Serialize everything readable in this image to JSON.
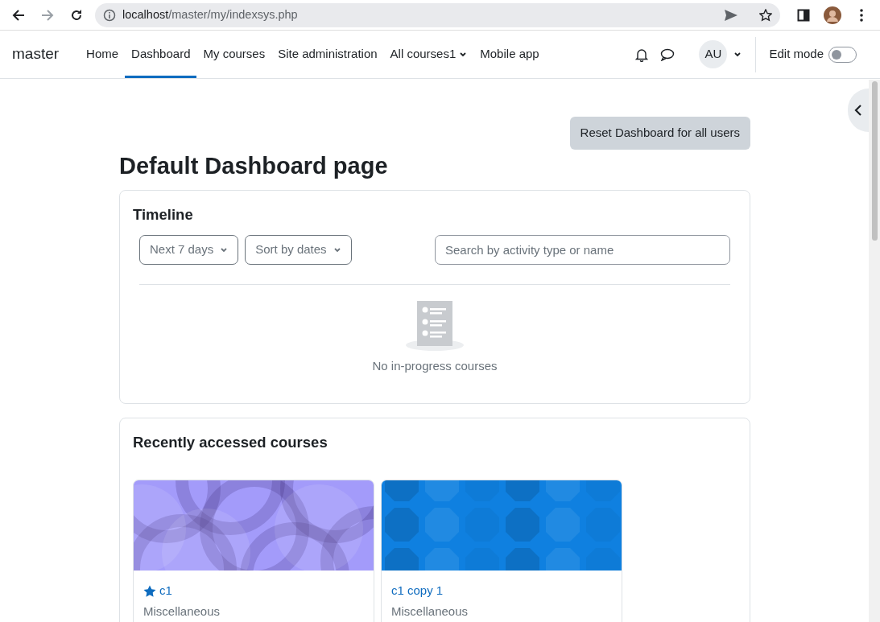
{
  "browser": {
    "url_host": "localhost",
    "url_path": "/master/my/indexsys.php"
  },
  "navbar": {
    "brand": "master",
    "items": [
      {
        "label": "Home",
        "selected": false,
        "dropdown": false
      },
      {
        "label": "Dashboard",
        "selected": true,
        "dropdown": false
      },
      {
        "label": "My courses",
        "selected": false,
        "dropdown": false
      },
      {
        "label": "Site administration",
        "selected": false,
        "dropdown": false
      },
      {
        "label": "All courses1",
        "selected": false,
        "dropdown": true
      },
      {
        "label": "Mobile app",
        "selected": false,
        "dropdown": false
      }
    ],
    "avatar": "AU",
    "edit_mode": {
      "label": "Edit mode",
      "on": false
    }
  },
  "reset_button": "Reset Dashboard for all users",
  "page_title": "Default Dashboard page",
  "timeline": {
    "title": "Timeline",
    "filters": [
      {
        "label": "Next 7 days"
      },
      {
        "label": "Sort by dates"
      }
    ],
    "search": {
      "placeholder": "Search by activity type or name"
    },
    "empty_text": "No in-progress courses"
  },
  "recent": {
    "title": "Recently accessed courses",
    "courses": [
      {
        "name": "c1",
        "category": "Miscellaneous",
        "starred": true,
        "kind": "circles",
        "color": "#a39bfa"
      },
      {
        "name": "c1 copy 1",
        "category": "Miscellaneous",
        "starred": false,
        "kind": "octagons",
        "color": "#0f80e0"
      }
    ]
  }
}
